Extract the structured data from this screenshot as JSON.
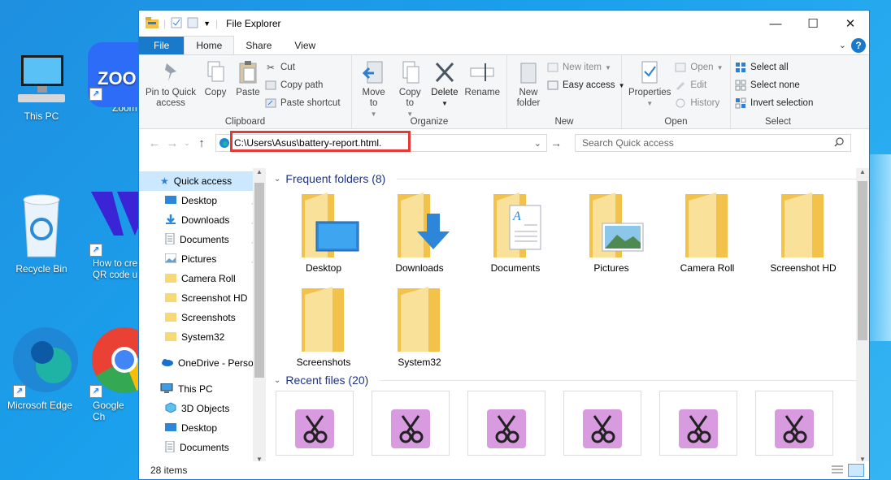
{
  "desktop": {
    "icons": [
      {
        "label": "This PC",
        "icon": "this-pc-icon"
      },
      {
        "label": "Zoom",
        "icon": "zoom-icon"
      },
      {
        "label": "Recycle Bin",
        "icon": "recycle-bin-icon"
      },
      {
        "label": "How to cre QR code u",
        "icon": "app-shortcut-icon"
      },
      {
        "label": "Microsoft Edge",
        "icon": "edge-icon"
      },
      {
        "label": "Google Ch",
        "icon": "chrome-icon"
      }
    ]
  },
  "window": {
    "title": "File Explorer",
    "controls": {
      "minimize": "—",
      "maximize": "☐",
      "close": "✕"
    }
  },
  "tabs": [
    "File",
    "Home",
    "Share",
    "View"
  ],
  "ribbon": {
    "clipboard": {
      "label": "Clipboard",
      "pin": "Pin to Quick access",
      "copy": "Copy",
      "paste": "Paste",
      "cut": "Cut",
      "copy_path": "Copy path",
      "paste_shortcut": "Paste shortcut"
    },
    "organize": {
      "label": "Organize",
      "move_to": "Move to",
      "copy_to": "Copy to",
      "delete": "Delete",
      "rename": "Rename"
    },
    "new": {
      "label": "New",
      "new_folder": "New folder",
      "new_item": "New item",
      "easy_access": "Easy access"
    },
    "open": {
      "label": "Open",
      "properties": "Properties",
      "open": "Open",
      "edit": "Edit",
      "history": "History"
    },
    "select": {
      "label": "Select",
      "select_all": "Select all",
      "select_none": "Select none",
      "invert": "Invert selection"
    }
  },
  "address": {
    "path": "C:\\Users\\Asus\\battery-report.html.",
    "search_placeholder": "Search Quick access"
  },
  "nav": {
    "items": [
      {
        "label": "Quick access",
        "pinned": false,
        "selected": true
      },
      {
        "label": "Desktop",
        "pinned": true
      },
      {
        "label": "Downloads",
        "pinned": true
      },
      {
        "label": "Documents",
        "pinned": true
      },
      {
        "label": "Pictures",
        "pinned": true
      },
      {
        "label": "Camera Roll",
        "pinned": false
      },
      {
        "label": "Screenshot HD",
        "pinned": false
      },
      {
        "label": "Screenshots",
        "pinned": false
      },
      {
        "label": "System32",
        "pinned": false
      },
      {
        "label": "OneDrive - Persor",
        "pinned": false
      },
      {
        "label": "This PC",
        "pinned": false
      },
      {
        "label": "3D Objects",
        "pinned": false
      },
      {
        "label": "Desktop",
        "pinned": false
      },
      {
        "label": "Documents",
        "pinned": false
      }
    ]
  },
  "main": {
    "frequent_header": "Frequent folders (8)",
    "folders": [
      "Desktop",
      "Downloads",
      "Documents",
      "Pictures",
      "Camera Roll",
      "Screenshot HD",
      "Screenshots",
      "System32"
    ],
    "recent_header": "Recent files (20)",
    "recent_count": 6
  },
  "status": {
    "items": "28 items"
  },
  "colors": {
    "accent": "#1979ca",
    "highlight": "#e53935",
    "folder": "#f8d775",
    "selected": "#cce8ff"
  }
}
